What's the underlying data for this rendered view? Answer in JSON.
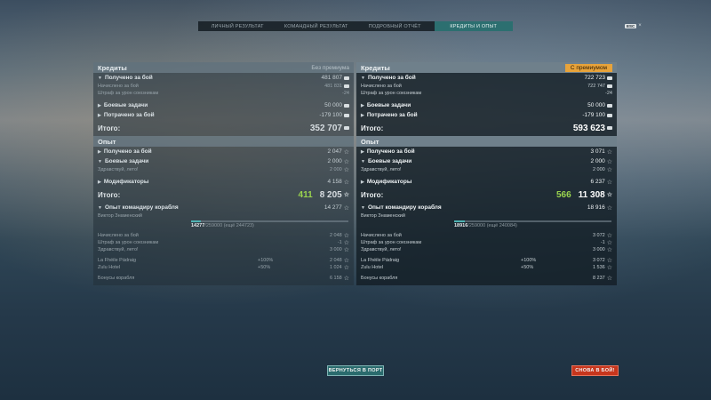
{
  "tabs": [
    {
      "label": "ЛИЧНЫЙ РЕЗУЛЬТАТ"
    },
    {
      "label": "КОМАНДНЫЙ РЕЗУЛЬТАТ"
    },
    {
      "label": "ПОДРОБНЫЙ ОТЧЁТ"
    },
    {
      "label": "КРЕДИТЫ И ОПЫТ"
    }
  ],
  "esc": {
    "key": "ESC",
    "close": "×"
  },
  "left": {
    "credits_title": "Кредиты",
    "premium_tag": "Без премиума",
    "earned_label": "Получено за бой",
    "earned_value": "481 807",
    "accrued_label": "Начислено за бой",
    "accrued_value": "481 831",
    "penalty_label": "Штраф за урон союзникам",
    "penalty_value": "-24",
    "missions_label": "Боевые задачи",
    "missions_value": "50 000",
    "spent_label": "Потрачено за бой",
    "spent_value": "-179 100",
    "total_label": "Итого:",
    "total_value": "352 707",
    "xp_title": "Опыт",
    "xp_earned_label": "Получено за бой",
    "xp_earned_value": "2 047",
    "xp_missions_label": "Боевые задачи",
    "xp_missions_value": "2 000",
    "xp_hello_label": "Здравствуй, лето!",
    "xp_hello_value": "2 000",
    "mods_label": "Модификаторы",
    "mods_value": "4 158",
    "xp_total_label": "Итого:",
    "xp_total_green": "411",
    "xp_total_value": "8 205",
    "cmd_label": "Опыт командиру корабля",
    "cmd_value": "14 277",
    "commander": "Виктор Знаменский",
    "bar_current": "14277",
    "bar_rest": "/259000  (ещё 244723)",
    "c_accrued_label": "Начислено за бой",
    "c_accrued_value": "2 048",
    "c_penalty_label": "Штраф за урон союзникам",
    "c_penalty_value": "-1",
    "c_hello_label": "Здравствуй, лето!",
    "c_hello_value": "3 000",
    "flag1_label": "La Fhéile Pádraig",
    "flag1_pct": "+100%",
    "flag1_value": "2 048",
    "flag2_label": "Zulu Hotel",
    "flag2_pct": "+50%",
    "flag2_value": "1 024",
    "bonus_label": "Бонусы корабля",
    "bonus_value": "6 158"
  },
  "right": {
    "credits_title": "Кредиты",
    "premium_tag": "С премиумом",
    "earned_label": "Получено за бой",
    "earned_value": "722 723",
    "accrued_label": "Начислено за бой",
    "accrued_value": "722 747",
    "penalty_label": "Штраф за урон союзникам",
    "penalty_value": "-24",
    "missions_label": "Боевые задачи",
    "missions_value": "50 000",
    "spent_label": "Потрачено за бой",
    "spent_value": "-179 100",
    "total_label": "Итого:",
    "total_value": "593 623",
    "xp_title": "Опыт",
    "xp_earned_label": "Получено за бой",
    "xp_earned_value": "3 071",
    "xp_missions_label": "Боевые задачи",
    "xp_missions_value": "2 000",
    "xp_hello_label": "Здравствуй, лето!",
    "xp_hello_value": "2 000",
    "mods_label": "Модификаторы",
    "mods_value": "6 237",
    "xp_total_label": "Итого:",
    "xp_total_green": "566",
    "xp_total_value": "11 308",
    "cmd_label": "Опыт командиру корабля",
    "cmd_value": "18 916",
    "commander": "Виктор Знаменский",
    "bar_current": "18916",
    "bar_rest": "/259000  (ещё 240084)",
    "c_accrued_label": "Начислено за бой",
    "c_accrued_value": "3 072",
    "c_penalty_label": "Штраф за урон союзникам",
    "c_penalty_value": "-1",
    "c_hello_label": "Здравствуй, лето!",
    "c_hello_value": "3 000",
    "flag1_label": "La Fhéile Pádraig",
    "flag1_pct": "+100%",
    "flag1_value": "3 072",
    "flag2_label": "Zulu Hotel",
    "flag2_pct": "+50%",
    "flag2_value": "1 536",
    "bonus_label": "Бонусы корабля",
    "bonus_value": "8 237"
  },
  "buttons": {
    "port": "ВЕРНУТЬСЯ В ПОРТ",
    "again": "СНОВА В БОЙ!"
  }
}
